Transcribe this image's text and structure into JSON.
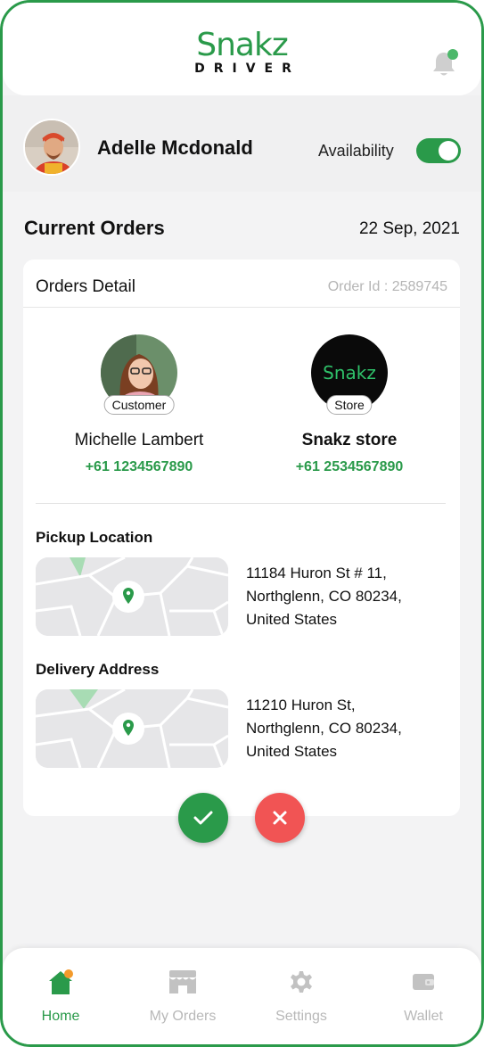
{
  "app": {
    "logo_main": "Snakz",
    "logo_sub": "DRIVER"
  },
  "driver": {
    "name": "Adelle Mcdonald",
    "availability_label": "Availability",
    "available": true
  },
  "orders": {
    "title": "Current Orders",
    "date": "22 Sep, 2021",
    "card_title": "Orders Detail",
    "order_id": "Order Id : 2589745",
    "customer": {
      "tag": "Customer",
      "name": "Michelle Lambert",
      "phone": "+61 1234567890"
    },
    "store": {
      "tag": "Store",
      "logo_text": "Snakz",
      "name": "Snakz store",
      "phone": "+61 2534567890"
    },
    "pickup": {
      "label": "Pickup Location",
      "address_line1": "11184 Huron St # 11,",
      "address_line2": "Northglenn, CO 80234,",
      "address_line3": "United States"
    },
    "delivery": {
      "label": "Delivery Address",
      "address_line1": "11210 Huron St,",
      "address_line2": "Northglenn, CO 80234,",
      "address_line3": "United States"
    }
  },
  "nav": {
    "items": [
      {
        "label": "Home",
        "icon": "home-icon",
        "active": true
      },
      {
        "label": "My Orders",
        "icon": "store-icon",
        "active": false
      },
      {
        "label": "Settings",
        "icon": "gear-icon",
        "active": false
      },
      {
        "label": "Wallet",
        "icon": "wallet-icon",
        "active": false
      }
    ]
  },
  "colors": {
    "accent": "#2a9a4a",
    "reject": "#f15454"
  }
}
